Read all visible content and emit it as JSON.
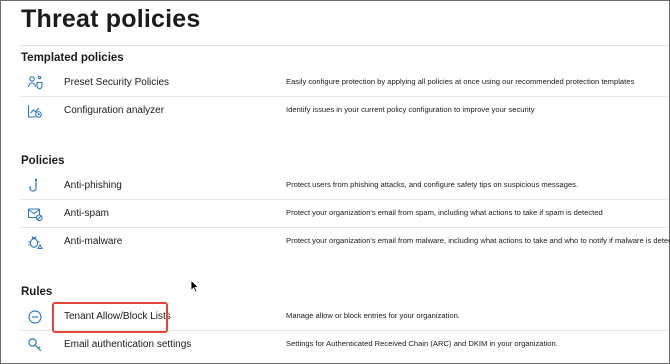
{
  "page": {
    "title": "Threat policies"
  },
  "sections": [
    {
      "title": "Templated policies",
      "items": [
        {
          "name": "Preset Security Policies",
          "icon": "preset-security-icon",
          "description": "Easily configure protection by applying all policies at once using our recommended protection templates"
        },
        {
          "name": "Configuration analyzer",
          "icon": "configuration-analyzer-icon",
          "description": "Identify issues in your current policy configuration to improve your security"
        }
      ]
    },
    {
      "title": "Policies",
      "items": [
        {
          "name": "Anti-phishing",
          "icon": "anti-phishing-icon",
          "description": "Protect users from phishing attacks, and configure safety tips on suspicious messages."
        },
        {
          "name": "Anti-spam",
          "icon": "anti-spam-icon",
          "description": "Protect your organization's email from spam, including what actions to take if spam is detected"
        },
        {
          "name": "Anti-malware",
          "icon": "anti-malware-icon",
          "description": "Protect your organization's email from malware, including what actions to take and who to notify if malware is detected"
        }
      ]
    },
    {
      "title": "Rules",
      "items": [
        {
          "name": "Tenant Allow/Block Lists",
          "icon": "block-list-icon",
          "description": "Manage allow or block entries for your organization."
        },
        {
          "name": "Email authentication settings",
          "icon": "key-search-icon",
          "description": "Settings for Authenticated Received Chain (ARC) and DKIM in your organization."
        }
      ]
    }
  ],
  "colors": {
    "icon": "#2e79c4",
    "highlight": "#e0463a"
  }
}
